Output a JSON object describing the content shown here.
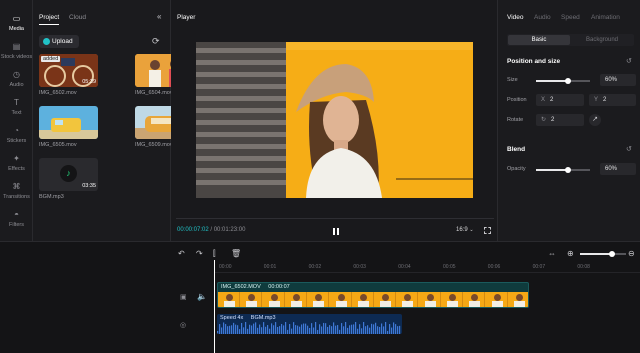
{
  "rail": [
    {
      "label": "Media",
      "icon": "media-icon",
      "active": true
    },
    {
      "label": "Stock videos",
      "icon": "stock-videos-icon"
    },
    {
      "label": "Audio",
      "icon": "audio-icon"
    },
    {
      "label": "Text",
      "icon": "text-icon"
    },
    {
      "label": "Stickers",
      "icon": "stickers-icon"
    },
    {
      "label": "Effects",
      "icon": "effects-icon"
    },
    {
      "label": "Transitions",
      "icon": "transitions-icon"
    },
    {
      "label": "Filters",
      "icon": "filters-icon"
    }
  ],
  "media": {
    "tabs": [
      "Project",
      "Cloud"
    ],
    "upload": "Upload",
    "items": [
      {
        "name": "IMG_6502.mov",
        "duration": "05:39",
        "badge": "added",
        "color": "#b5542c"
      },
      {
        "name": "IMG_6504.mov",
        "duration": "",
        "color": "#e8a13a"
      },
      {
        "name": "IMG_6505.mov",
        "duration": "",
        "color": "#4aa7d8"
      },
      {
        "name": "IMG_6509.mov",
        "duration": "",
        "color": "#d4a13b"
      },
      {
        "name": "BGM.mp3",
        "duration": "03:35",
        "color": "#2a2a2e"
      }
    ]
  },
  "player": {
    "title": "Player",
    "current": "00:00:07:02",
    "total": "/ 00:01:23:00",
    "ratio": "16:9",
    "accent": "#21c2c7"
  },
  "props": {
    "tabs": [
      "Video",
      "Audio",
      "Speed",
      "Animation"
    ],
    "subtabs": [
      "Basic",
      "Background"
    ],
    "position_title": "Position and size",
    "size_label": "Size",
    "size_value": "60%",
    "size_level": 0.6,
    "position_label": "Position",
    "pos_x_label": "X",
    "pos_x": "2",
    "pos_y_label": "Y",
    "pos_y": "2",
    "rotate_label": "Rotate",
    "rotate_value": "2",
    "blend_title": "Blend",
    "opacity_label": "Opacity",
    "opacity_value": "60%",
    "opacity_level": 0.6
  },
  "timeline": {
    "ticks": [
      "00:00",
      "00:01",
      "00:02",
      "00:03",
      "00:04",
      "00:05",
      "00:06",
      "00:07",
      "00:08"
    ],
    "video_clip": {
      "name": "IMG_6502.MOV",
      "time": "00:00:07"
    },
    "audio_clip": {
      "speed": "Speed 4x",
      "name": "BGM.mp3"
    }
  }
}
